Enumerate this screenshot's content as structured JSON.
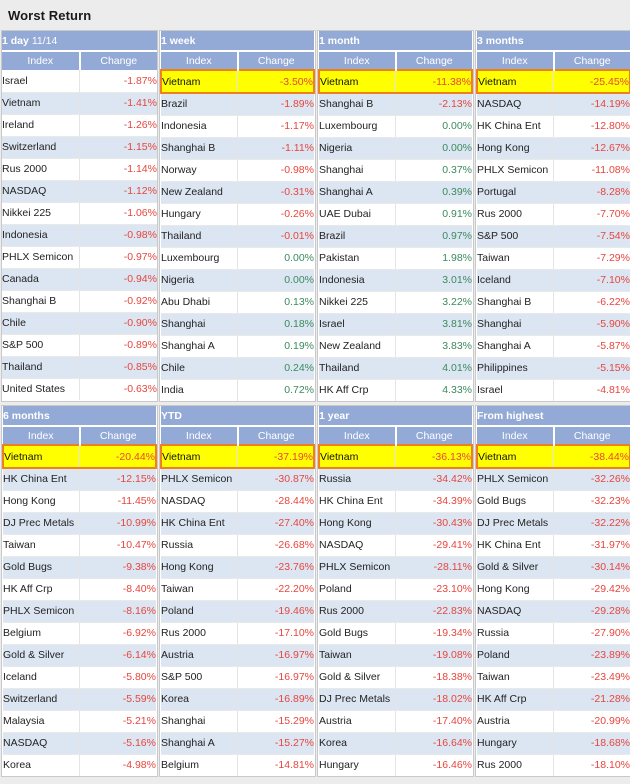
{
  "page": {
    "title": "Worst Return",
    "background_color": "#ececec",
    "header_color": "#93a9d6",
    "highlight_fill": "#ffff00",
    "highlight_border": "#f0801e",
    "negative_color": "#e8453c",
    "positive_color": "#3b8a5c",
    "stripe_color": "#dce6f2"
  },
  "columns": {
    "index_label": "Index",
    "change_label": "Change"
  },
  "tables": [
    {
      "caption": "1 day",
      "caption_sub": "11/14",
      "rows": [
        {
          "index": "Israel",
          "change": "-1.87%",
          "sign": "neg",
          "highlight": false
        },
        {
          "index": "Vietnam",
          "change": "-1.41%",
          "sign": "neg",
          "highlight": false
        },
        {
          "index": "Ireland",
          "change": "-1.26%",
          "sign": "neg",
          "highlight": false
        },
        {
          "index": "Switzerland",
          "change": "-1.15%",
          "sign": "neg",
          "highlight": false
        },
        {
          "index": "Rus 2000",
          "change": "-1.14%",
          "sign": "neg",
          "highlight": false
        },
        {
          "index": "NASDAQ",
          "change": "-1.12%",
          "sign": "neg",
          "highlight": false
        },
        {
          "index": "Nikkei 225",
          "change": "-1.06%",
          "sign": "neg",
          "highlight": false
        },
        {
          "index": "Indonesia",
          "change": "-0.98%",
          "sign": "neg",
          "highlight": false
        },
        {
          "index": "PHLX Semicon",
          "change": "-0.97%",
          "sign": "neg",
          "highlight": false
        },
        {
          "index": "Canada",
          "change": "-0.94%",
          "sign": "neg",
          "highlight": false
        },
        {
          "index": "Shanghai B",
          "change": "-0.92%",
          "sign": "neg",
          "highlight": false
        },
        {
          "index": "Chile",
          "change": "-0.90%",
          "sign": "neg",
          "highlight": false
        },
        {
          "index": "S&P 500",
          "change": "-0.89%",
          "sign": "neg",
          "highlight": false
        },
        {
          "index": "Thailand",
          "change": "-0.85%",
          "sign": "neg",
          "highlight": false
        },
        {
          "index": "United States",
          "change": "-0.63%",
          "sign": "neg",
          "highlight": false
        }
      ]
    },
    {
      "caption": "1 week",
      "caption_sub": "",
      "rows": [
        {
          "index": "Vietnam",
          "change": "-3.50%",
          "sign": "neg",
          "highlight": true
        },
        {
          "index": "Brazil",
          "change": "-1.89%",
          "sign": "neg",
          "highlight": false
        },
        {
          "index": "Indonesia",
          "change": "-1.17%",
          "sign": "neg",
          "highlight": false
        },
        {
          "index": "Shanghai B",
          "change": "-1.11%",
          "sign": "neg",
          "highlight": false
        },
        {
          "index": "Norway",
          "change": "-0.98%",
          "sign": "neg",
          "highlight": false
        },
        {
          "index": "New Zealand",
          "change": "-0.31%",
          "sign": "neg",
          "highlight": false
        },
        {
          "index": "Hungary",
          "change": "-0.26%",
          "sign": "neg",
          "highlight": false
        },
        {
          "index": "Thailand",
          "change": "-0.01%",
          "sign": "neg",
          "highlight": false
        },
        {
          "index": "Luxembourg",
          "change": "0.00%",
          "sign": "pos",
          "highlight": false
        },
        {
          "index": "Nigeria",
          "change": "0.00%",
          "sign": "pos",
          "highlight": false
        },
        {
          "index": "Abu Dhabi",
          "change": "0.13%",
          "sign": "pos",
          "highlight": false
        },
        {
          "index": "Shanghai",
          "change": "0.18%",
          "sign": "pos",
          "highlight": false
        },
        {
          "index": "Shanghai A",
          "change": "0.19%",
          "sign": "pos",
          "highlight": false
        },
        {
          "index": "Chile",
          "change": "0.24%",
          "sign": "pos",
          "highlight": false
        },
        {
          "index": "India",
          "change": "0.72%",
          "sign": "pos",
          "highlight": false
        }
      ]
    },
    {
      "caption": "1 month",
      "caption_sub": "",
      "rows": [
        {
          "index": "Vietnam",
          "change": "-11.38%",
          "sign": "neg",
          "highlight": true
        },
        {
          "index": "Shanghai B",
          "change": "-2.13%",
          "sign": "neg",
          "highlight": false
        },
        {
          "index": "Luxembourg",
          "change": "0.00%",
          "sign": "pos",
          "highlight": false
        },
        {
          "index": "Nigeria",
          "change": "0.00%",
          "sign": "pos",
          "highlight": false
        },
        {
          "index": "Shanghai",
          "change": "0.37%",
          "sign": "pos",
          "highlight": false
        },
        {
          "index": "Shanghai A",
          "change": "0.39%",
          "sign": "pos",
          "highlight": false
        },
        {
          "index": "UAE Dubai",
          "change": "0.91%",
          "sign": "pos",
          "highlight": false
        },
        {
          "index": "Brazil",
          "change": "0.97%",
          "sign": "pos",
          "highlight": false
        },
        {
          "index": "Pakistan",
          "change": "1.98%",
          "sign": "pos",
          "highlight": false
        },
        {
          "index": "Indonesia",
          "change": "3.01%",
          "sign": "pos",
          "highlight": false
        },
        {
          "index": "Nikkei 225",
          "change": "3.22%",
          "sign": "pos",
          "highlight": false
        },
        {
          "index": "Israel",
          "change": "3.81%",
          "sign": "pos",
          "highlight": false
        },
        {
          "index": "New Zealand",
          "change": "3.83%",
          "sign": "pos",
          "highlight": false
        },
        {
          "index": "Thailand",
          "change": "4.01%",
          "sign": "pos",
          "highlight": false
        },
        {
          "index": "HK Aff Crp",
          "change": "4.33%",
          "sign": "pos",
          "highlight": false
        }
      ]
    },
    {
      "caption": "3 months",
      "caption_sub": "",
      "rows": [
        {
          "index": "Vietnam",
          "change": "-25.45%",
          "sign": "neg",
          "highlight": true
        },
        {
          "index": "NASDAQ",
          "change": "-14.19%",
          "sign": "neg",
          "highlight": false
        },
        {
          "index": "HK China Ent",
          "change": "-12.80%",
          "sign": "neg",
          "highlight": false
        },
        {
          "index": "Hong Kong",
          "change": "-12.67%",
          "sign": "neg",
          "highlight": false
        },
        {
          "index": "PHLX Semicon",
          "change": "-11.08%",
          "sign": "neg",
          "highlight": false
        },
        {
          "index": "Portugal",
          "change": "-8.28%",
          "sign": "neg",
          "highlight": false
        },
        {
          "index": "Rus 2000",
          "change": "-7.70%",
          "sign": "neg",
          "highlight": false
        },
        {
          "index": "S&P 500",
          "change": "-7.54%",
          "sign": "neg",
          "highlight": false
        },
        {
          "index": "Taiwan",
          "change": "-7.29%",
          "sign": "neg",
          "highlight": false
        },
        {
          "index": "Iceland",
          "change": "-7.10%",
          "sign": "neg",
          "highlight": false
        },
        {
          "index": "Shanghai B",
          "change": "-6.22%",
          "sign": "neg",
          "highlight": false
        },
        {
          "index": "Shanghai",
          "change": "-5.90%",
          "sign": "neg",
          "highlight": false
        },
        {
          "index": "Shanghai A",
          "change": "-5.87%",
          "sign": "neg",
          "highlight": false
        },
        {
          "index": "Philippines",
          "change": "-5.15%",
          "sign": "neg",
          "highlight": false
        },
        {
          "index": "Israel",
          "change": "-4.81%",
          "sign": "neg",
          "highlight": false
        }
      ]
    },
    {
      "caption": "6 months",
      "caption_sub": "",
      "rows": [
        {
          "index": "Vietnam",
          "change": "-20.44%",
          "sign": "neg",
          "highlight": true
        },
        {
          "index": "HK China Ent",
          "change": "-12.15%",
          "sign": "neg",
          "highlight": false
        },
        {
          "index": "Hong Kong",
          "change": "-11.45%",
          "sign": "neg",
          "highlight": false
        },
        {
          "index": "DJ Prec Metals",
          "change": "-10.99%",
          "sign": "neg",
          "highlight": false
        },
        {
          "index": "Taiwan",
          "change": "-10.47%",
          "sign": "neg",
          "highlight": false
        },
        {
          "index": "Gold Bugs",
          "change": "-9.38%",
          "sign": "neg",
          "highlight": false
        },
        {
          "index": "HK Aff Crp",
          "change": "-8.40%",
          "sign": "neg",
          "highlight": false
        },
        {
          "index": "PHLX Semicon",
          "change": "-8.16%",
          "sign": "neg",
          "highlight": false
        },
        {
          "index": "Belgium",
          "change": "-6.92%",
          "sign": "neg",
          "highlight": false
        },
        {
          "index": "Gold & Silver",
          "change": "-6.14%",
          "sign": "neg",
          "highlight": false
        },
        {
          "index": "Iceland",
          "change": "-5.80%",
          "sign": "neg",
          "highlight": false
        },
        {
          "index": "Switzerland",
          "change": "-5.59%",
          "sign": "neg",
          "highlight": false
        },
        {
          "index": "Malaysia",
          "change": "-5.21%",
          "sign": "neg",
          "highlight": false
        },
        {
          "index": "NASDAQ",
          "change": "-5.16%",
          "sign": "neg",
          "highlight": false
        },
        {
          "index": "Korea",
          "change": "-4.98%",
          "sign": "neg",
          "highlight": false
        }
      ]
    },
    {
      "caption": "YTD",
      "caption_sub": "",
      "rows": [
        {
          "index": "Vietnam",
          "change": "-37.19%",
          "sign": "neg",
          "highlight": true
        },
        {
          "index": "PHLX Semicon",
          "change": "-30.87%",
          "sign": "neg",
          "highlight": false
        },
        {
          "index": "NASDAQ",
          "change": "-28.44%",
          "sign": "neg",
          "highlight": false
        },
        {
          "index": "HK China Ent",
          "change": "-27.40%",
          "sign": "neg",
          "highlight": false
        },
        {
          "index": "Russia",
          "change": "-26.68%",
          "sign": "neg",
          "highlight": false
        },
        {
          "index": "Hong Kong",
          "change": "-23.76%",
          "sign": "neg",
          "highlight": false
        },
        {
          "index": "Taiwan",
          "change": "-22.20%",
          "sign": "neg",
          "highlight": false
        },
        {
          "index": "Poland",
          "change": "-19.46%",
          "sign": "neg",
          "highlight": false
        },
        {
          "index": "Rus 2000",
          "change": "-17.10%",
          "sign": "neg",
          "highlight": false
        },
        {
          "index": "Austria",
          "change": "-16.97%",
          "sign": "neg",
          "highlight": false
        },
        {
          "index": "S&P 500",
          "change": "-16.97%",
          "sign": "neg",
          "highlight": false
        },
        {
          "index": "Korea",
          "change": "-16.89%",
          "sign": "neg",
          "highlight": false
        },
        {
          "index": "Shanghai",
          "change": "-15.29%",
          "sign": "neg",
          "highlight": false
        },
        {
          "index": "Shanghai A",
          "change": "-15.27%",
          "sign": "neg",
          "highlight": false
        },
        {
          "index": "Belgium",
          "change": "-14.81%",
          "sign": "neg",
          "highlight": false
        }
      ]
    },
    {
      "caption": "1 year",
      "caption_sub": "",
      "rows": [
        {
          "index": "Vietnam",
          "change": "-36.13%",
          "sign": "neg",
          "highlight": true
        },
        {
          "index": "Russia",
          "change": "-34.42%",
          "sign": "neg",
          "highlight": false
        },
        {
          "index": "HK China Ent",
          "change": "-34.39%",
          "sign": "neg",
          "highlight": false
        },
        {
          "index": "Hong Kong",
          "change": "-30.43%",
          "sign": "neg",
          "highlight": false
        },
        {
          "index": "NASDAQ",
          "change": "-29.41%",
          "sign": "neg",
          "highlight": false
        },
        {
          "index": "PHLX Semicon",
          "change": "-28.11%",
          "sign": "neg",
          "highlight": false
        },
        {
          "index": "Poland",
          "change": "-23.10%",
          "sign": "neg",
          "highlight": false
        },
        {
          "index": "Rus 2000",
          "change": "-22.83%",
          "sign": "neg",
          "highlight": false
        },
        {
          "index": "Gold Bugs",
          "change": "-19.34%",
          "sign": "neg",
          "highlight": false
        },
        {
          "index": "Taiwan",
          "change": "-19.08%",
          "sign": "neg",
          "highlight": false
        },
        {
          "index": "Gold & Silver",
          "change": "-18.38%",
          "sign": "neg",
          "highlight": false
        },
        {
          "index": "DJ Prec Metals",
          "change": "-18.02%",
          "sign": "neg",
          "highlight": false
        },
        {
          "index": "Austria",
          "change": "-17.40%",
          "sign": "neg",
          "highlight": false
        },
        {
          "index": "Korea",
          "change": "-16.64%",
          "sign": "neg",
          "highlight": false
        },
        {
          "index": "Hungary",
          "change": "-16.46%",
          "sign": "neg",
          "highlight": false
        }
      ]
    },
    {
      "caption": "From highest",
      "caption_sub": "",
      "rows": [
        {
          "index": "Vietnam",
          "change": "-38.44%",
          "sign": "neg",
          "highlight": true
        },
        {
          "index": "PHLX Semicon",
          "change": "-32.26%",
          "sign": "neg",
          "highlight": false
        },
        {
          "index": "Gold Bugs",
          "change": "-32.23%",
          "sign": "neg",
          "highlight": false
        },
        {
          "index": "DJ Prec Metals",
          "change": "-32.22%",
          "sign": "neg",
          "highlight": false
        },
        {
          "index": "HK China Ent",
          "change": "-31.97%",
          "sign": "neg",
          "highlight": false
        },
        {
          "index": "Gold & Silver",
          "change": "-30.14%",
          "sign": "neg",
          "highlight": false
        },
        {
          "index": "Hong Kong",
          "change": "-29.42%",
          "sign": "neg",
          "highlight": false
        },
        {
          "index": "NASDAQ",
          "change": "-29.28%",
          "sign": "neg",
          "highlight": false
        },
        {
          "index": "Russia",
          "change": "-27.90%",
          "sign": "neg",
          "highlight": false
        },
        {
          "index": "Poland",
          "change": "-23.89%",
          "sign": "neg",
          "highlight": false
        },
        {
          "index": "Taiwan",
          "change": "-23.49%",
          "sign": "neg",
          "highlight": false
        },
        {
          "index": "HK Aff Crp",
          "change": "-21.28%",
          "sign": "neg",
          "highlight": false
        },
        {
          "index": "Austria",
          "change": "-20.99%",
          "sign": "neg",
          "highlight": false
        },
        {
          "index": "Hungary",
          "change": "-18.68%",
          "sign": "neg",
          "highlight": false
        },
        {
          "index": "Rus 2000",
          "change": "-18.10%",
          "sign": "neg",
          "highlight": false
        }
      ]
    }
  ]
}
